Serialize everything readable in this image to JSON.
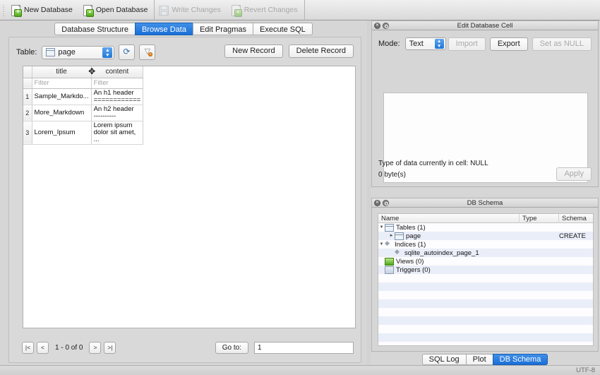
{
  "toolbar": {
    "items": [
      {
        "label": "New Database",
        "icon": "new-database-icon",
        "enabled": true
      },
      {
        "label": "Open Database",
        "icon": "open-database-icon",
        "enabled": true
      },
      {
        "label": "Write Changes",
        "icon": "write-changes-icon",
        "enabled": false
      },
      {
        "label": "Revert Changes",
        "icon": "revert-changes-icon",
        "enabled": false
      }
    ]
  },
  "main_tabs": {
    "items": [
      {
        "label": "Database Structure",
        "active": false
      },
      {
        "label": "Browse Data",
        "active": true
      },
      {
        "label": "Edit Pragmas",
        "active": false
      },
      {
        "label": "Execute SQL",
        "active": false
      }
    ]
  },
  "browse": {
    "table_label": "Table:",
    "table_value": "page",
    "refresh_icon": "refresh-icon",
    "filter_icon": "clear-filter-icon",
    "new_record_label": "New Record",
    "delete_record_label": "Delete Record",
    "grid": {
      "columns": [
        "title",
        "content"
      ],
      "filter_placeholder": "Filter",
      "rows": [
        {
          "num": "1",
          "title": "Sample_Markdo...",
          "content": "An h1 header\n============"
        },
        {
          "num": "2",
          "title": "More_Markdown",
          "content": "An h2 header\n----------"
        },
        {
          "num": "3",
          "title": "Lorem_Ipsum",
          "content": "Lorem ipsum\ndolor sit amet, ..."
        }
      ]
    },
    "pager": {
      "first_label": "|<",
      "prev_label": "<",
      "count_label": "1 - 0 of 0",
      "next_label": ">",
      "last_label": ">|",
      "goto_label": "Go to:",
      "goto_value": "1"
    }
  },
  "edit_cell": {
    "title": "Edit Database Cell",
    "mode_label": "Mode:",
    "mode_value": "Text",
    "import_label": "Import",
    "export_label": "Export",
    "set_null_label": "Set as NULL",
    "editor_value": "",
    "type_info": "Type of data currently in cell: NULL",
    "size_info": "0 byte(s)",
    "apply_label": "Apply"
  },
  "db_schema": {
    "title": "DB Schema",
    "headers": [
      "Name",
      "Type",
      "Schema"
    ],
    "rows": [
      {
        "name": "Tables (1)",
        "indent": 0,
        "twisty": "▼",
        "icon": "table-group-icon",
        "type": "",
        "schema": ""
      },
      {
        "name": "page",
        "indent": 1,
        "twisty": "►",
        "icon": "table-icon",
        "type": "",
        "schema": "CREATE "
      },
      {
        "name": "Indices (1)",
        "indent": 0,
        "twisty": "▼",
        "icon": "index-group-icon",
        "type": "",
        "schema": ""
      },
      {
        "name": "sqlite_autoindex_page_1",
        "indent": 1,
        "twisty": "",
        "icon": "index-icon",
        "type": "",
        "schema": ""
      },
      {
        "name": "Views (0)",
        "indent": 0,
        "twisty": "",
        "icon": "view-icon",
        "type": "",
        "schema": ""
      },
      {
        "name": "Triggers (0)",
        "indent": 0,
        "twisty": "",
        "icon": "trigger-icon",
        "type": "",
        "schema": ""
      }
    ]
  },
  "dock_tabs": {
    "items": [
      {
        "label": "SQL Log",
        "active": false
      },
      {
        "label": "Plot",
        "active": false
      },
      {
        "label": "DB Schema",
        "active": true
      }
    ]
  },
  "status_bar": {
    "encoding": "UTF-8"
  }
}
